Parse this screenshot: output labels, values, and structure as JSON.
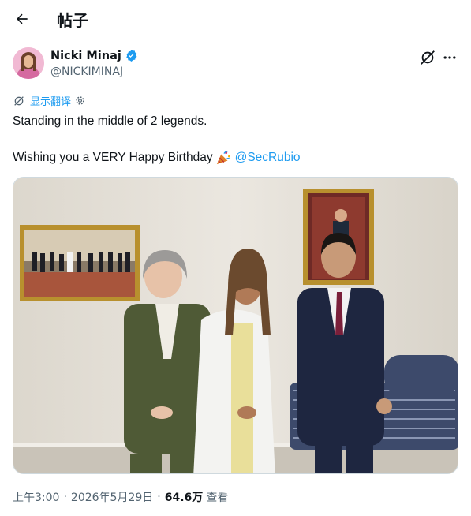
{
  "header": {
    "title": "帖子"
  },
  "author": {
    "name": "Nicki Minaj",
    "handle": "@NICKIMINAJ"
  },
  "translate": {
    "label": "显示翻译"
  },
  "tweet": {
    "line1": "Standing in the middle of 2 legends.",
    "line2": "Wishing you a VERY Happy Birthday",
    "mention": "@SecRubio"
  },
  "meta": {
    "time": "上午3:00",
    "date": "2026年5月29日",
    "separator": "·",
    "views_count": "64.6万",
    "views_label": "查看"
  },
  "colors": {
    "link": "#1d9bf0",
    "muted": "#536471",
    "text": "#0f1419"
  },
  "icons": {
    "back": "arrow-left-icon",
    "verified": "verified-badge-icon",
    "grok": "grok-icon",
    "more": "more-icon",
    "translate": "translate-icon",
    "gear": "gear-icon",
    "party": "party-popper-icon"
  }
}
